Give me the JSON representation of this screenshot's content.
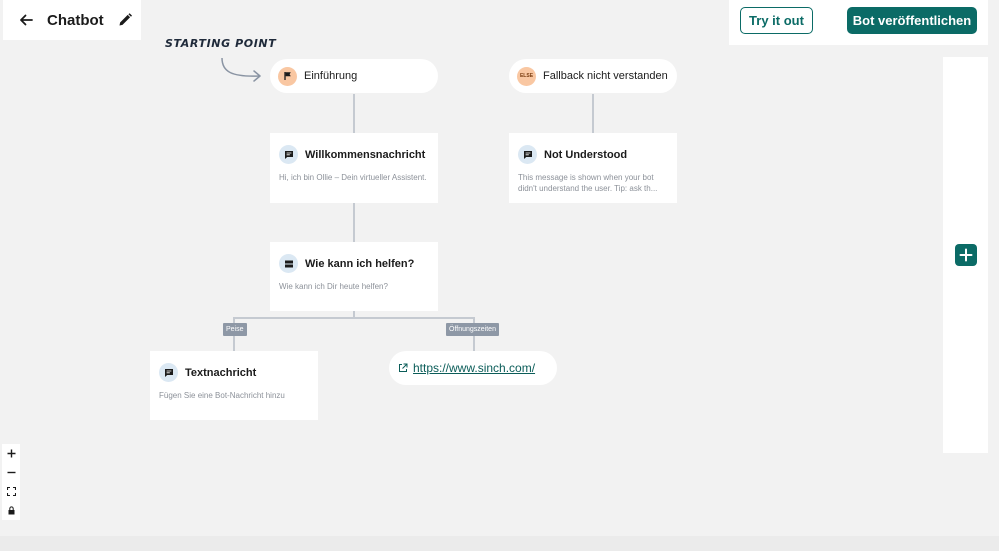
{
  "header": {
    "back_icon": "arrow-left-icon",
    "title": "Chatbot",
    "edit_icon": "pencil-icon"
  },
  "actions": {
    "try_label": "Try it out",
    "publish_label": "Bot veröffentlichen"
  },
  "canvas": {
    "starting_point_label": "STARTING POINT",
    "nodes": {
      "intro": {
        "label": "Einführung",
        "icon": "flag-icon"
      },
      "fallback": {
        "label": "Fallback nicht verstanden",
        "icon": "else-badge",
        "badge_text": "ELSE"
      },
      "welcome": {
        "title": "Willkommensnachricht",
        "icon": "chat-bubble-icon",
        "description": "Hi, ich bin Ollie – Dein virtueller Assistent."
      },
      "not_understood": {
        "title": "Not Understood",
        "icon": "chat-bubble-icon",
        "description": "This message is shown when your bot didn't understand the user. Tip: ask th..."
      },
      "question": {
        "title": "Wie kann ich helfen?",
        "icon": "buttons-icon",
        "description": "Wie kann ich Dir heute helfen?"
      },
      "text_message": {
        "title": "Textnachricht",
        "icon": "chat-bubble-icon",
        "description": "Fügen Sie eine Bot-Nachricht hinzu"
      },
      "link": {
        "url": "https://www.sinch.com/",
        "icon": "external-link-icon"
      }
    },
    "branches": [
      {
        "label": "Peise"
      },
      {
        "label": "Öffnungszeiten"
      }
    ]
  },
  "zoom_controls": [
    "zoom-in-icon",
    "zoom-out-icon",
    "fit-view-icon",
    "lock-icon"
  ],
  "colors": {
    "brand": "#0b6b66",
    "canvas": "#f2f2f2",
    "connector": "#c5cad1",
    "branch_tag": "#8e98a6",
    "flag_circle": "#f9c7a2",
    "message_circle": "#dbe8f3"
  }
}
